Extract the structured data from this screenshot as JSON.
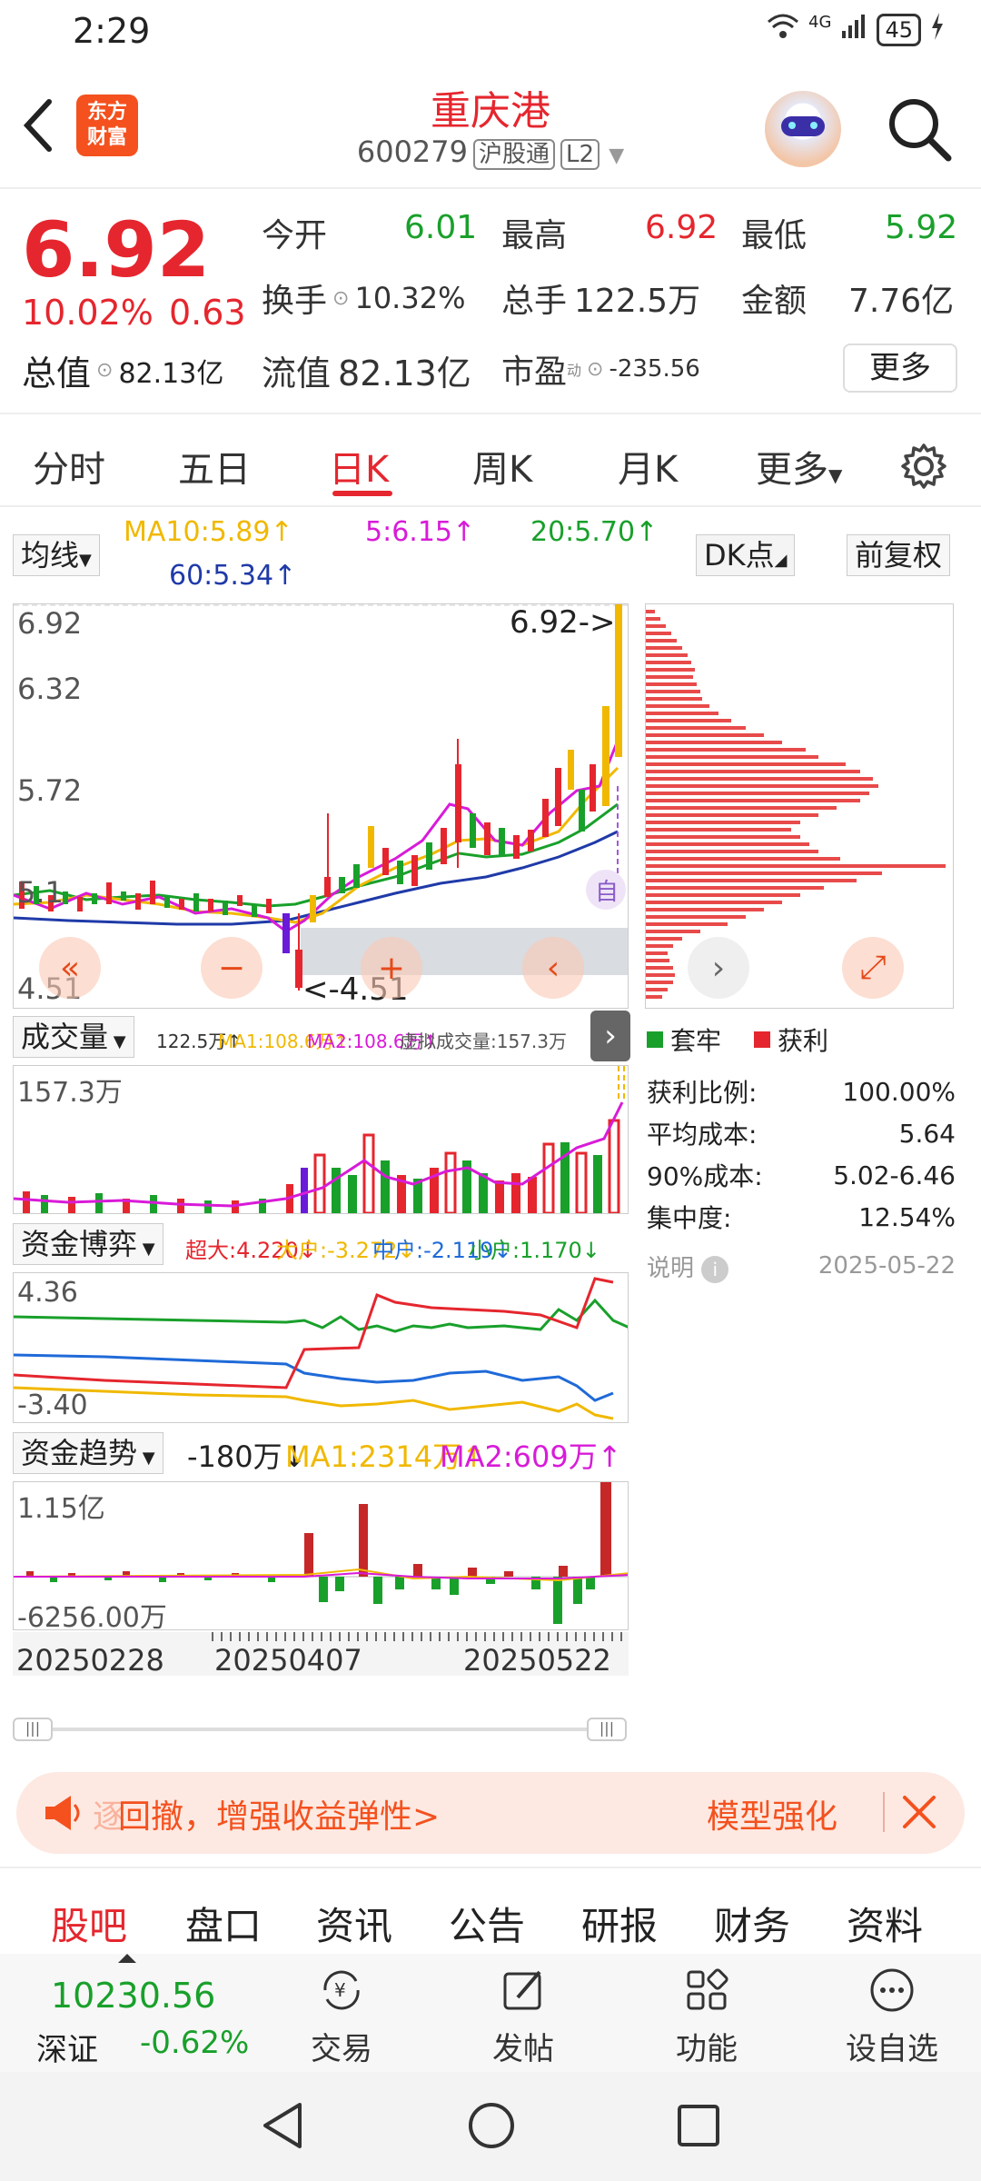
{
  "status": {
    "time": "2:29",
    "signal": "4G",
    "battery": "45"
  },
  "header": {
    "logo_line1": "东方",
    "logo_line2": "财富",
    "title": "重庆港",
    "code": "600279",
    "tag1": "沪股通",
    "tag2": "L2"
  },
  "quote": {
    "price": "6.92",
    "pct": "10.02%",
    "chg": "0.63",
    "open_label": "今开",
    "open": "6.01",
    "high_label": "最高",
    "high": "6.92",
    "low_label": "最低",
    "low": "5.92",
    "turnover_label": "换手",
    "turnover": "10.32%",
    "volume_label": "总手",
    "volume": "122.5万",
    "amount_label": "金额",
    "amount": "7.76亿",
    "mktcap_label": "总值",
    "mktcap": "82.13亿",
    "float_label": "流值",
    "float": "82.13亿",
    "pe_label": "市盈",
    "pe_sup": "动",
    "pe": "-235.56",
    "more": "更多"
  },
  "tabs": [
    "分时",
    "五日",
    "日K",
    "周K",
    "月K",
    "更多"
  ],
  "ma": {
    "selector": "均线",
    "ma10": "MA10:5.89↑",
    "ma5": "5:6.15↑",
    "ma20": "20:5.70↑",
    "ma60": "60:5.34↑",
    "dk": "DK点",
    "adjust": "前复权"
  },
  "kline": {
    "y_top": "6.92",
    "y2": "6.32",
    "y3": "5.72",
    "y4": "5.1",
    "y_bottom": "4.51",
    "max_marker": "6.92->",
    "min_marker": "<-4.51",
    "auto": "自"
  },
  "chip": {
    "legend_trap": "套牢",
    "legend_profit": "获利",
    "rows": [
      {
        "k": "获利比例:",
        "v": "100.00%"
      },
      {
        "k": "平均成本:",
        "v": "5.64"
      },
      {
        "k": "90%成本:",
        "v": "5.02-6.46"
      },
      {
        "k": "集中度:",
        "v": "12.54%"
      }
    ],
    "note": "说明",
    "date": "2025-05-22"
  },
  "volume": {
    "selector": "成交量",
    "info1": "122.5万↑",
    "info2": "MA1:108.6万↑",
    "info3": "MA2:108.6万↑",
    "info4": "虚拟成交量:157.3万",
    "ymax": "157.3万"
  },
  "fund": {
    "selector": "资金博弈",
    "i1": "超大:4.220↓",
    "i2": "大户:-3.272↓",
    "i3": "中户:-2.119↓",
    "i4": "小户:1.170↓",
    "ytop": "4.36",
    "ybot": "-3.40"
  },
  "trend": {
    "selector": "资金趋势",
    "val": "-180万↓",
    "ma1": "MA1:2314万↑",
    "ma2": "MA2:609万↑",
    "ytop": "1.15亿",
    "ybot": "-6256.00万"
  },
  "dates": [
    "20250228",
    "20250407",
    "20250522"
  ],
  "banner": {
    "left": "回撤，增强收益弹性>",
    "right": "模型强化",
    "prefix": "逐"
  },
  "bottom_tabs": [
    "股吧",
    "盘口",
    "资讯",
    "公告",
    "研报",
    "财务",
    "资料"
  ],
  "footer": {
    "index_value": "10230.56",
    "index_name": "深证",
    "index_pct": "-0.62%",
    "trade": "交易",
    "post": "发帖",
    "func": "功能",
    "watch": "设自选"
  },
  "colors": {
    "red": "#e5262e",
    "green": "#19a02b",
    "accent": "#f4511e",
    "yellow": "#f0b800",
    "blue": "#1f3aa8",
    "magenta": "#d81bd8"
  }
}
